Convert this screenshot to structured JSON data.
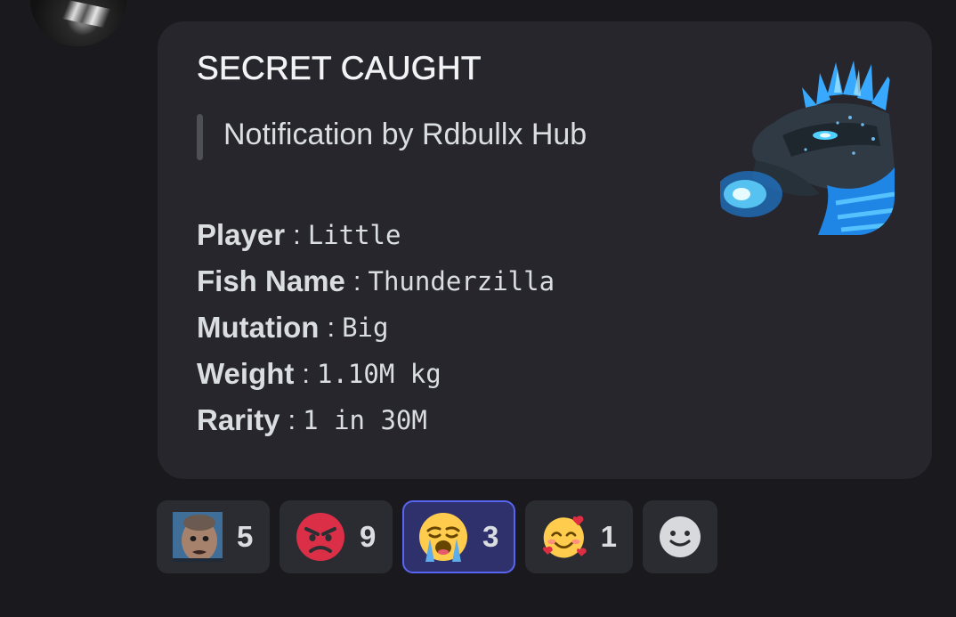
{
  "embed": {
    "title": "SECRET CAUGHT",
    "description": "Notification by Rdbullx Hub",
    "fields": [
      {
        "name": "Player",
        "value": "Little"
      },
      {
        "name": "Fish Name",
        "value": "Thunderzilla"
      },
      {
        "name": "Mutation",
        "value": "Big"
      },
      {
        "name": "Weight",
        "value": "1.10M kg"
      },
      {
        "name": "Rarity",
        "value": "1 in 30M"
      }
    ],
    "separator": ":"
  },
  "reactions": [
    {
      "emoji": "custom-face-emoji",
      "count": "5",
      "active": false
    },
    {
      "emoji": "angry-face-emoji",
      "count": "9",
      "active": false
    },
    {
      "emoji": "loudly-crying-face-emoji",
      "count": "3",
      "active": true
    },
    {
      "emoji": "smiling-face-with-hearts-emoji",
      "count": "1",
      "active": false
    }
  ],
  "add_reaction": {
    "icon": "add-reaction-smiley-icon"
  },
  "colors": {
    "background": "#1a1a1e",
    "embed_bg": "#26262c",
    "reaction_bg": "#2b2c32",
    "reaction_active_bg": "#2e316c",
    "reaction_active_border": "#5865f2"
  }
}
